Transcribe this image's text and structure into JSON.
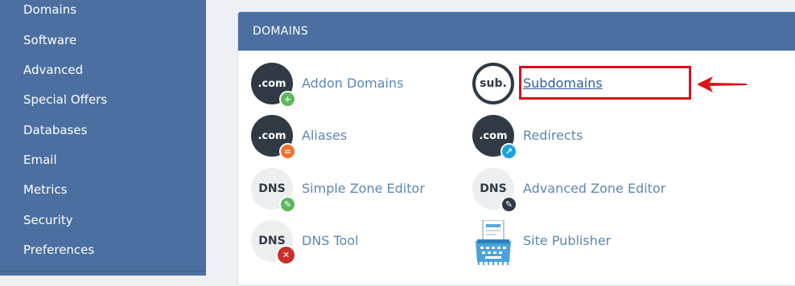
{
  "sidebar": {
    "items": [
      {
        "label": "Domains"
      },
      {
        "label": "Software"
      },
      {
        "label": "Advanced"
      },
      {
        "label": "Special Offers"
      },
      {
        "label": "Databases"
      },
      {
        "label": "Email"
      },
      {
        "label": "Metrics"
      },
      {
        "label": "Security"
      },
      {
        "label": "Preferences"
      }
    ]
  },
  "panel": {
    "title": "DOMAINS",
    "items": [
      {
        "label": "Addon Domains",
        "icon_text": ".com",
        "badge": "+",
        "badge_color": "#5cb85c",
        "icon": "addon-domains-icon"
      },
      {
        "label": "Subdomains",
        "icon_text": "sub.",
        "icon": "subdomains-icon"
      },
      {
        "label": "Aliases",
        "icon_text": ".com",
        "badge": "=",
        "badge_color": "#f0712c",
        "icon": "aliases-icon"
      },
      {
        "label": "Redirects",
        "icon_text": ".com",
        "badge": "↗",
        "badge_color": "#1aa3e0",
        "icon": "redirects-icon"
      },
      {
        "label": "Simple Zone Editor",
        "icon_text": "DNS",
        "badge": "✎",
        "badge_color": "#5cb85c",
        "icon": "simple-zone-editor-icon"
      },
      {
        "label": "Advanced Zone Editor",
        "icon_text": "DNS",
        "badge": "✎",
        "badge_color": "#2f3a45",
        "icon": "advanced-zone-editor-icon"
      },
      {
        "label": "DNS Tool",
        "icon_text": "DNS",
        "badge": "✕",
        "badge_color": "#c9302c",
        "icon": "dns-tool-icon"
      },
      {
        "label": "Site Publisher",
        "icon": "site-publisher-icon"
      }
    ]
  },
  "colors": {
    "sidebar_bg": "#4a6fa0",
    "header_bg": "#4a6fa0",
    "link": "#5d86b5",
    "highlight": "#d6101a"
  }
}
